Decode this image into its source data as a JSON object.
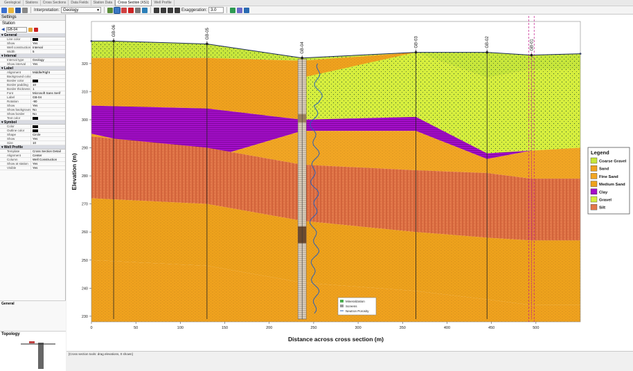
{
  "tabs": [
    "Geological",
    "Stations",
    "Cross Sections",
    "Data Fields",
    "Station Data",
    "Cross Section (XS1)",
    "Well Profile"
  ],
  "active_tab_index": 5,
  "toolbar": {
    "interpretation_label": "Interpretation:",
    "interpretation_value": "Geology",
    "exaggeration_label": "Exaggeration:",
    "exaggeration_value": "3.0"
  },
  "left": {
    "settings_title": "Settings",
    "station_label": "Station",
    "station_value": "GB-04",
    "groups": [
      {
        "name": "General",
        "rows": [
          [
            "Line color",
            "#000000"
          ],
          [
            "Show",
            "Yes"
          ],
          [
            "Well construction",
            "Interval"
          ],
          [
            "Width",
            "5"
          ]
        ]
      },
      {
        "name": "Interval",
        "rows": [
          [
            "Interval type",
            "Geology"
          ],
          [
            "Show interval",
            "Yes"
          ]
        ]
      },
      {
        "name": "Label",
        "rows": [
          [
            "Alignment",
            "Middle/Right"
          ],
          [
            "Background color",
            ""
          ],
          [
            "Border color",
            "#000000"
          ],
          [
            "Border padding",
            "10"
          ],
          [
            "Border thickness",
            "1"
          ],
          [
            "Font",
            "Microsoft Sans Serif"
          ],
          [
            "Label",
            "GB-04"
          ],
          [
            "Rotation",
            "-90"
          ],
          [
            "Show",
            "Yes"
          ],
          [
            "Show background",
            "No"
          ],
          [
            "Show border",
            "No"
          ],
          [
            "Text color",
            "#000000"
          ]
        ]
      },
      {
        "name": "Symbol",
        "rows": [
          [
            "Color",
            "#000000"
          ],
          [
            "Outline color",
            "#000000"
          ],
          [
            "Shape",
            "Circle"
          ],
          [
            "Show",
            "Yes"
          ],
          [
            "Size",
            "10"
          ]
        ]
      },
      {
        "name": "Well Profile",
        "rows": [
          [
            "Template",
            "Cross Section Detail"
          ],
          [
            "Alignment",
            "Center"
          ],
          [
            "Column",
            "Well Construction"
          ],
          [
            "Show at station",
            "Yes"
          ],
          [
            "Visible",
            "Yes"
          ]
        ]
      }
    ],
    "general_pane_title": "General",
    "topology_title": "Topology"
  },
  "colors": {
    "coarse_gravel": "#c7e63b",
    "sand": "#f0a21e",
    "fine_sand": "#f2a624",
    "medium_sand": "#eea21c",
    "clay": "#a40ec9",
    "gravel": "#d6ee3e",
    "silt": "#e3784a",
    "ground_line": "#1a2a5a",
    "well_column": "#cfc3b3"
  },
  "chart_data": {
    "type": "area",
    "xlabel": "Distance across cross section (m)",
    "ylabel": "Elevation (m)",
    "xlim": [
      0,
      550
    ],
    "ylim": [
      228,
      335
    ],
    "xticks": [
      0,
      50,
      100,
      150,
      200,
      250,
      300,
      350,
      400,
      450,
      500
    ],
    "yticks": [
      230,
      240,
      250,
      260,
      270,
      280,
      290,
      300,
      310,
      320
    ],
    "stations": [
      {
        "name": "GB-06",
        "x": 25,
        "top": 328
      },
      {
        "name": "GB-05",
        "x": 130,
        "top": 327
      },
      {
        "name": "GB-04",
        "x": 237,
        "top": 322
      },
      {
        "name": "GB-03",
        "x": 365,
        "top": 324
      },
      {
        "name": "GB-02",
        "x": 445,
        "top": 324
      },
      {
        "name": "GB-01",
        "x": 495,
        "top": 323
      }
    ],
    "legend_title": "Legend",
    "legend": [
      "Coarse Gravel",
      "Sand",
      "Fine Sand",
      "Medium Sand",
      "Clay",
      "Gravel",
      "Silt"
    ],
    "well_legend": [
      "Mineralization",
      "Screens",
      "Neutron Porosity"
    ]
  },
  "status_text": "[Cross section tools: drag elevations, 0 shown]"
}
